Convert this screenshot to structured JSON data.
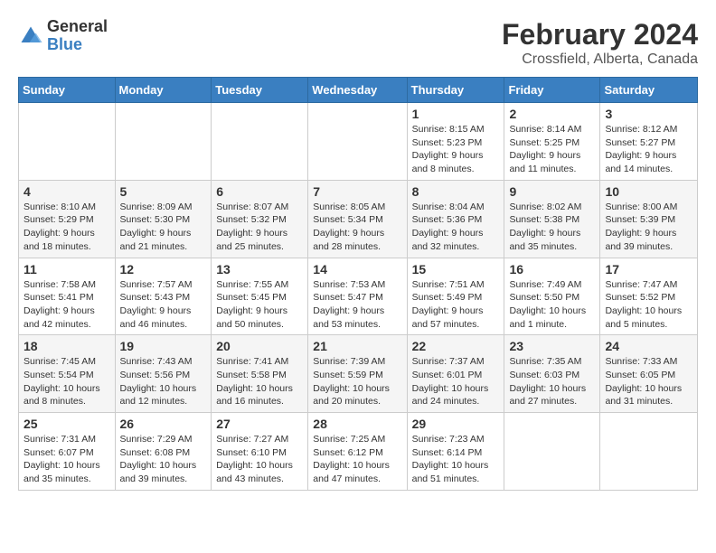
{
  "logo": {
    "general": "General",
    "blue": "Blue"
  },
  "title": "February 2024",
  "location": "Crossfield, Alberta, Canada",
  "days_of_week": [
    "Sunday",
    "Monday",
    "Tuesday",
    "Wednesday",
    "Thursday",
    "Friday",
    "Saturday"
  ],
  "weeks": [
    [
      {
        "day": "",
        "info": ""
      },
      {
        "day": "",
        "info": ""
      },
      {
        "day": "",
        "info": ""
      },
      {
        "day": "",
        "info": ""
      },
      {
        "day": "1",
        "info": "Sunrise: 8:15 AM\nSunset: 5:23 PM\nDaylight: 9 hours\nand 8 minutes."
      },
      {
        "day": "2",
        "info": "Sunrise: 8:14 AM\nSunset: 5:25 PM\nDaylight: 9 hours\nand 11 minutes."
      },
      {
        "day": "3",
        "info": "Sunrise: 8:12 AM\nSunset: 5:27 PM\nDaylight: 9 hours\nand 14 minutes."
      }
    ],
    [
      {
        "day": "4",
        "info": "Sunrise: 8:10 AM\nSunset: 5:29 PM\nDaylight: 9 hours\nand 18 minutes."
      },
      {
        "day": "5",
        "info": "Sunrise: 8:09 AM\nSunset: 5:30 PM\nDaylight: 9 hours\nand 21 minutes."
      },
      {
        "day": "6",
        "info": "Sunrise: 8:07 AM\nSunset: 5:32 PM\nDaylight: 9 hours\nand 25 minutes."
      },
      {
        "day": "7",
        "info": "Sunrise: 8:05 AM\nSunset: 5:34 PM\nDaylight: 9 hours\nand 28 minutes."
      },
      {
        "day": "8",
        "info": "Sunrise: 8:04 AM\nSunset: 5:36 PM\nDaylight: 9 hours\nand 32 minutes."
      },
      {
        "day": "9",
        "info": "Sunrise: 8:02 AM\nSunset: 5:38 PM\nDaylight: 9 hours\nand 35 minutes."
      },
      {
        "day": "10",
        "info": "Sunrise: 8:00 AM\nSunset: 5:39 PM\nDaylight: 9 hours\nand 39 minutes."
      }
    ],
    [
      {
        "day": "11",
        "info": "Sunrise: 7:58 AM\nSunset: 5:41 PM\nDaylight: 9 hours\nand 42 minutes."
      },
      {
        "day": "12",
        "info": "Sunrise: 7:57 AM\nSunset: 5:43 PM\nDaylight: 9 hours\nand 46 minutes."
      },
      {
        "day": "13",
        "info": "Sunrise: 7:55 AM\nSunset: 5:45 PM\nDaylight: 9 hours\nand 50 minutes."
      },
      {
        "day": "14",
        "info": "Sunrise: 7:53 AM\nSunset: 5:47 PM\nDaylight: 9 hours\nand 53 minutes."
      },
      {
        "day": "15",
        "info": "Sunrise: 7:51 AM\nSunset: 5:49 PM\nDaylight: 9 hours\nand 57 minutes."
      },
      {
        "day": "16",
        "info": "Sunrise: 7:49 AM\nSunset: 5:50 PM\nDaylight: 10 hours\nand 1 minute."
      },
      {
        "day": "17",
        "info": "Sunrise: 7:47 AM\nSunset: 5:52 PM\nDaylight: 10 hours\nand 5 minutes."
      }
    ],
    [
      {
        "day": "18",
        "info": "Sunrise: 7:45 AM\nSunset: 5:54 PM\nDaylight: 10 hours\nand 8 minutes."
      },
      {
        "day": "19",
        "info": "Sunrise: 7:43 AM\nSunset: 5:56 PM\nDaylight: 10 hours\nand 12 minutes."
      },
      {
        "day": "20",
        "info": "Sunrise: 7:41 AM\nSunset: 5:58 PM\nDaylight: 10 hours\nand 16 minutes."
      },
      {
        "day": "21",
        "info": "Sunrise: 7:39 AM\nSunset: 5:59 PM\nDaylight: 10 hours\nand 20 minutes."
      },
      {
        "day": "22",
        "info": "Sunrise: 7:37 AM\nSunset: 6:01 PM\nDaylight: 10 hours\nand 24 minutes."
      },
      {
        "day": "23",
        "info": "Sunrise: 7:35 AM\nSunset: 6:03 PM\nDaylight: 10 hours\nand 27 minutes."
      },
      {
        "day": "24",
        "info": "Sunrise: 7:33 AM\nSunset: 6:05 PM\nDaylight: 10 hours\nand 31 minutes."
      }
    ],
    [
      {
        "day": "25",
        "info": "Sunrise: 7:31 AM\nSunset: 6:07 PM\nDaylight: 10 hours\nand 35 minutes."
      },
      {
        "day": "26",
        "info": "Sunrise: 7:29 AM\nSunset: 6:08 PM\nDaylight: 10 hours\nand 39 minutes."
      },
      {
        "day": "27",
        "info": "Sunrise: 7:27 AM\nSunset: 6:10 PM\nDaylight: 10 hours\nand 43 minutes."
      },
      {
        "day": "28",
        "info": "Sunrise: 7:25 AM\nSunset: 6:12 PM\nDaylight: 10 hours\nand 47 minutes."
      },
      {
        "day": "29",
        "info": "Sunrise: 7:23 AM\nSunset: 6:14 PM\nDaylight: 10 hours\nand 51 minutes."
      },
      {
        "day": "",
        "info": ""
      },
      {
        "day": "",
        "info": ""
      }
    ]
  ]
}
